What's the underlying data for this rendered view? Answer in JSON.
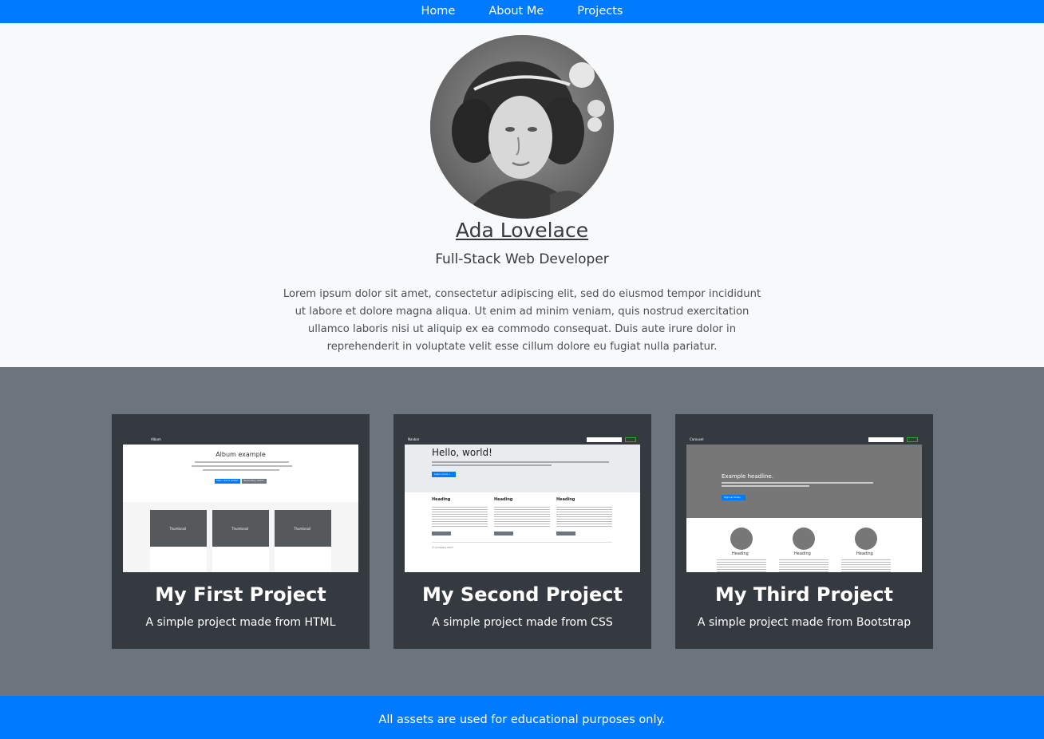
{
  "nav": {
    "items": [
      "Home",
      "About Me",
      "Projects"
    ]
  },
  "hero": {
    "name": "Ada Lovelace",
    "title": "Full-Stack Web Developer",
    "bio": "Lorem ipsum dolor sit amet, consectetur adipiscing elit, sed do eiusmod tempor incididunt ut labore et dolore magna aliqua. Ut enim ad minim veniam, quis nostrud exercitation ullamco laboris nisi ut aliquip ex ea commodo consequat. Duis aute irure dolor in reprehenderit in voluptate velit esse cillum dolore eu fugiat nulla pariatur."
  },
  "projects": [
    {
      "title": "My First Project",
      "description": "A simple project made from HTML",
      "preview": {
        "brand": "Album",
        "heading": "Album example",
        "button1": "Main call to action",
        "button2": "Secondary action",
        "thumb_label": "Thumbnail"
      }
    },
    {
      "title": "My Second Project",
      "description": "A simple project made from CSS",
      "preview": {
        "brand": "Navbar",
        "heading": "Hello, world!",
        "button": "Learn more »",
        "col_heading": "Heading",
        "col_button": "View details »",
        "footer": "© Company 2017"
      }
    },
    {
      "title": "My Third Project",
      "description": "A simple project made from Bootstrap",
      "preview": {
        "brand": "Carousel",
        "headline": "Example headline.",
        "button": "Sign up today",
        "col_heading": "Heading"
      }
    }
  ],
  "footer": {
    "text": "All assets are used for educational purposes only."
  },
  "colors": {
    "primary": "#007bff",
    "dark": "#343a40",
    "gray": "#6c757d",
    "light": "#f8f9fa"
  }
}
